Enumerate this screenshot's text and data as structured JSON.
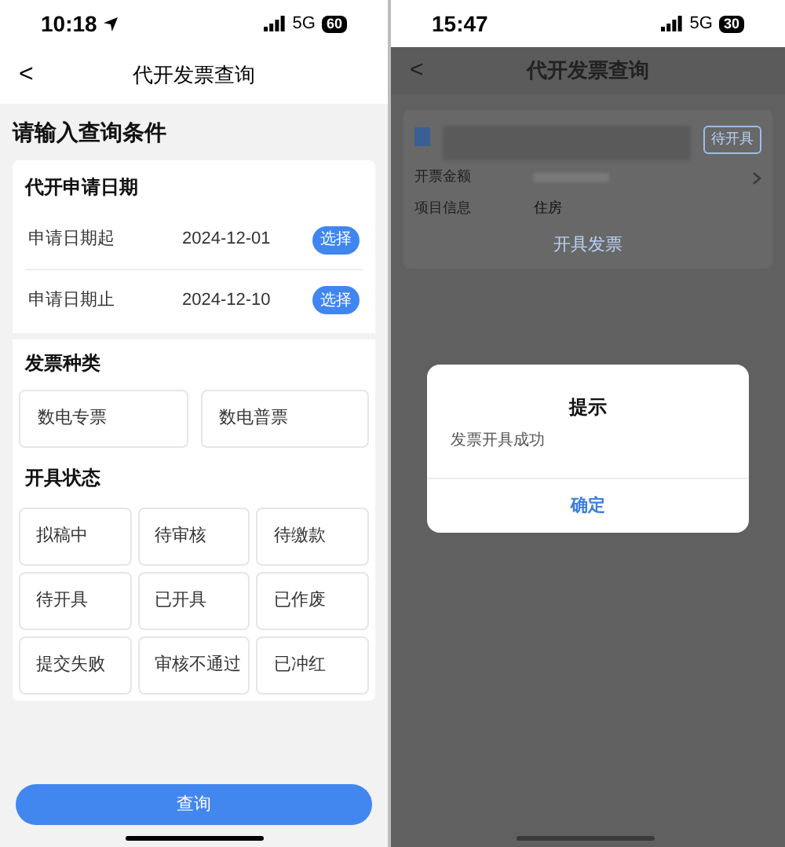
{
  "left_screen": {
    "status_bar": {
      "time": "10:18",
      "network": "5G",
      "battery": "60"
    },
    "nav": {
      "back": "<",
      "title": "代开发票查询"
    },
    "heading": "请输入查询条件",
    "date_section": {
      "title": "代开申请日期",
      "rows": [
        {
          "label": "申请日期起",
          "value": "2024-12-01",
          "button": "选择"
        },
        {
          "label": "申请日期止",
          "value": "2024-12-10",
          "button": "选择"
        }
      ]
    },
    "type_section": {
      "title": "发票种类",
      "options": [
        {
          "label": "数电专票",
          "selected": false
        },
        {
          "label": "数电普票",
          "selected": false
        }
      ]
    },
    "status_section": {
      "title": "开具状态",
      "options": [
        {
          "label": "拟稿中",
          "selected": false
        },
        {
          "label": "待审核",
          "selected": false
        },
        {
          "label": "待缴款",
          "selected": false
        },
        {
          "label": "待开具",
          "selected": false
        },
        {
          "label": "已开具",
          "selected": false
        },
        {
          "label": "已作废",
          "selected": false
        },
        {
          "label": "提交失败",
          "selected": false
        },
        {
          "label": "审核不通过",
          "selected": false
        },
        {
          "label": "已冲红",
          "selected": false
        }
      ]
    },
    "submit": "查询"
  },
  "right_screen": {
    "status_bar": {
      "time": "15:47",
      "network": "5G",
      "battery": "30"
    },
    "nav": {
      "back": "<",
      "title": "代开发票查询"
    },
    "card": {
      "status_tag": "待开具",
      "fields": [
        {
          "label": "开票金额",
          "value_blurred": true
        },
        {
          "label": "项目信息",
          "value": "住房"
        }
      ],
      "action": "开具发票"
    },
    "dialog": {
      "title": "提示",
      "message": "发票开具成功",
      "confirm": "确定"
    }
  }
}
